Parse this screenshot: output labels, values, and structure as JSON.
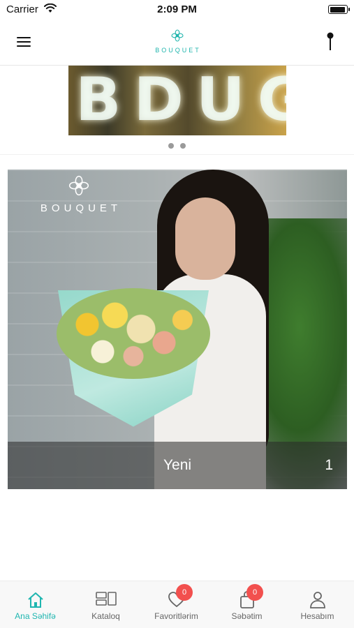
{
  "status_bar": {
    "carrier": "Carrier",
    "time": "2:09 PM",
    "wifi_icon": "wifi-icon",
    "battery_icon": "battery-icon"
  },
  "navbar": {
    "menu_icon": "hamburger-menu-icon",
    "logo_text": "BOUQUET",
    "location_icon": "map-pin-icon",
    "brand_color": "#20b5ad"
  },
  "banner": {
    "page_count": 2,
    "active_page": 1
  },
  "category_card": {
    "logo_text": "BOUQUET",
    "title": "Yeni",
    "count": "1"
  },
  "tabbar": {
    "active_color": "#1fb6b0",
    "badge_color": "#f2504e",
    "tabs": [
      {
        "label": "Ana Səhifə",
        "icon": "home-icon",
        "active": true
      },
      {
        "label": "Kataloq",
        "icon": "catalog-icon",
        "active": false
      },
      {
        "label": "Favoritlərim",
        "icon": "heart-icon",
        "active": false,
        "badge": "0"
      },
      {
        "label": "Səbətim",
        "icon": "cart-icon",
        "active": false,
        "badge": "0"
      },
      {
        "label": "Hesabım",
        "icon": "user-icon",
        "active": false
      }
    ]
  }
}
